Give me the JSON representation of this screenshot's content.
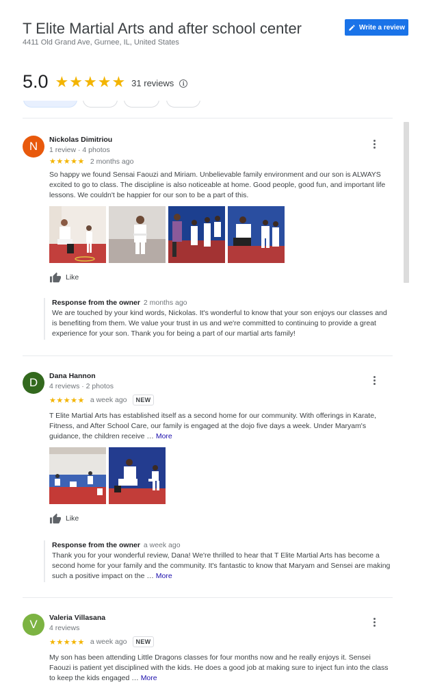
{
  "business": {
    "name": "T Elite Martial Arts and after school center",
    "address": "4411 Old Grand Ave, Gurnee, IL, United States",
    "rating": "5.0",
    "stars": "★★★★★",
    "reviews_count": "31 reviews",
    "info_glyph": "i"
  },
  "write_review": {
    "label": "Write a review",
    "icon": "pencil-icon"
  },
  "colors": {
    "accent": "#1a73e8",
    "star": "#f3b400",
    "link": "#1a0dab"
  },
  "reviews": [
    {
      "initial": "N",
      "avatar_color": "#e8590c",
      "name": "Nickolas Dimitriou",
      "meta": "1 review · 4 photos",
      "stars": "★★★★★",
      "date": "2 months ago",
      "text": "So happy we found Sensai Faouzi and Miriam. Unbelievable family environment and our son is ALWAYS excited to go to class.  The discipline is also noticeable at home.  Good people, good fun, and important life lessons.  We couldn't be happier for our son to be a part of this.",
      "like": "Like",
      "response": {
        "owner": "Response from the owner",
        "date": "2 months ago",
        "text": "We are touched by your kind words, Nickolas. It's wonderful to know that your son enjoys our classes and is benefiting from them. We value your trust in us and we're committed to continuing to provide a great experience for your son. Thank you for being a part of our martial arts family!"
      }
    },
    {
      "initial": "D",
      "avatar_color": "#33691e",
      "name": "Dana Hannon",
      "meta": "4 reviews · 2 photos",
      "stars": "★★★★★",
      "date": "a week ago",
      "badge": "NEW",
      "text": "T Elite Martial Arts has established itself as a second home for our community. With offerings in Karate, Fitness, and After School Care, our family is engaged at the dojo five days a week. Under Maryam's guidance, the children receive …",
      "more": "More",
      "like": "Like",
      "response": {
        "owner": "Response from the owner",
        "date": "a week ago",
        "text": "Thank you for your wonderful review, Dana! We're thrilled to hear that T Elite Martial Arts has become a second home for your family and the community. It's fantastic to know that Maryam and Sensei are making such a positive impact on the …",
        "more": "More"
      }
    },
    {
      "initial": "V",
      "avatar_color": "#7cb342",
      "name": "Valeria Villasana",
      "meta": "4 reviews",
      "stars": "★★★★★",
      "date": "a week ago",
      "badge": "NEW",
      "text": "My son has been attending Little Dragons classes for four months now and he really enjoys it. Sensei Faouzi is patient yet disciplined with the kids. He does a good job at making sure to inject fun into the class to keep the kids engaged …",
      "more": "More"
    }
  ]
}
